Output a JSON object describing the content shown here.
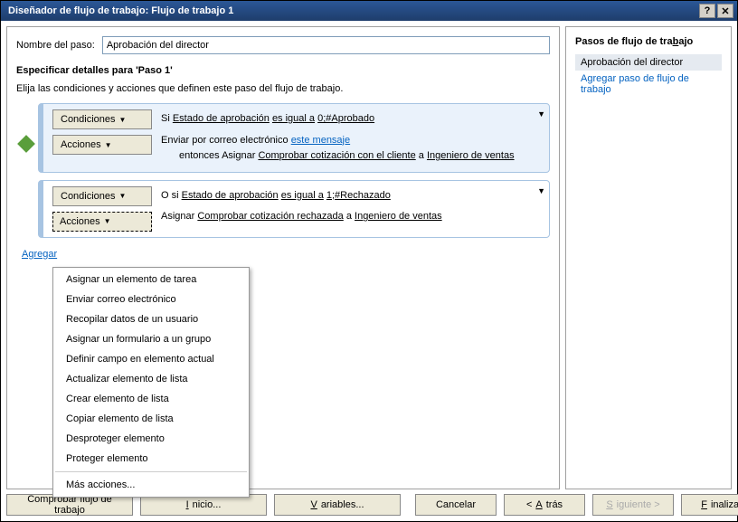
{
  "title": "Diseñador de flujo de trabajo: Flujo de trabajo 1",
  "titlebar": {
    "help": "?",
    "close": "✕"
  },
  "step": {
    "label": "Nombre del paso:",
    "value": "Aprobación del director"
  },
  "section": {
    "heading": "Especificar detalles para 'Paso 1'",
    "desc": "Elija las condiciones y acciones que definen este paso del flujo de trabajo."
  },
  "buttons": {
    "conditions": "Condiciones",
    "actions": "Acciones"
  },
  "branch1": {
    "cond": {
      "prefix": "Si ",
      "field": "Estado de aprobación",
      "op": "es igual a",
      "val": "0;#Aprobado"
    },
    "act1": {
      "prefix": "Enviar por correo electrónico ",
      "link": "este mensaje"
    },
    "act2": {
      "prefix": "entonces Asignar ",
      "link1": "Comprobar cotización con el cliente",
      "mid": " a ",
      "link2": "Ingeniero de ventas"
    }
  },
  "branch2": {
    "cond": {
      "prefix": "O si ",
      "field": "Estado de aprobación",
      "op": "es igual a",
      "val": "1;#Rechazado"
    },
    "act": {
      "prefix": "Asignar ",
      "link1": "Comprobar cotización rechazada",
      "mid": " a ",
      "link2": "Ingeniero de ventas"
    }
  },
  "add_branch": "Agregar",
  "menu": {
    "items": [
      "Asignar un elemento de tarea",
      "Enviar correo electrónico",
      "Recopilar datos de un usuario",
      "Asignar un formulario a un grupo",
      "Definir campo en elemento actual",
      "Actualizar elemento de lista",
      "Crear elemento de lista",
      "Copiar elemento de lista",
      "Desproteger elemento",
      "Proteger elemento"
    ],
    "more": "Más acciones..."
  },
  "side": {
    "title": "Pasos de flujo de trabajo",
    "item": "Aprobación del director",
    "add": "Agregar paso de flujo de trabajo"
  },
  "footer": {
    "check": "Comprobar flujo de trabajo",
    "start": "Inicio...",
    "vars": "Variables...",
    "cancel": "Cancelar",
    "back": "< Atrás",
    "next": "Siguiente >",
    "finish": "Finalizar"
  }
}
